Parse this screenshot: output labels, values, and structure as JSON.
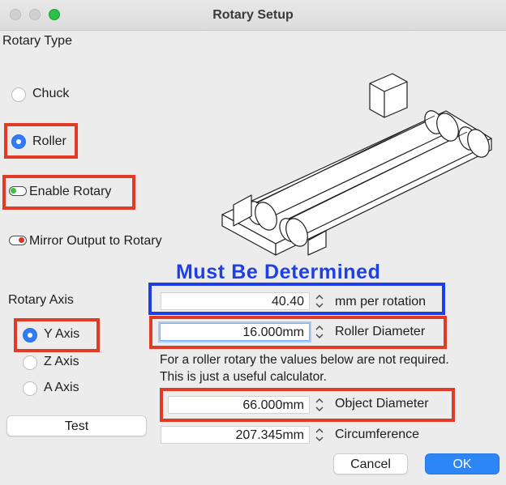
{
  "window": {
    "title": "Rotary Setup"
  },
  "rotary_type": {
    "heading": "Rotary Type",
    "options": [
      {
        "label": "Chuck",
        "selected": false
      },
      {
        "label": "Roller",
        "selected": true
      }
    ]
  },
  "toggles": {
    "enable_rotary": {
      "label": "Enable Rotary",
      "on": true,
      "color": "#39c23c"
    },
    "mirror_output": {
      "label": "Mirror Output to Rotary",
      "on": false,
      "color": "#d9342b"
    }
  },
  "rotary_axis": {
    "heading": "Rotary Axis",
    "options": [
      {
        "label": "Y Axis",
        "selected": true
      },
      {
        "label": "Z Axis",
        "selected": false
      },
      {
        "label": "A Axis",
        "selected": false
      }
    ]
  },
  "annotation": {
    "headline": "Must Be Determined"
  },
  "fields": {
    "mm_per_rotation": {
      "value": "40.40",
      "label": "mm per rotation"
    },
    "roller_diameter": {
      "value": "16.000mm",
      "label": "Roller Diameter"
    },
    "object_diameter": {
      "value": "66.000mm",
      "label": "Object Diameter"
    },
    "circumference": {
      "value": "207.345mm",
      "label": "Circumference"
    }
  },
  "note": {
    "line1": "For a roller rotary the values below are not required.",
    "line2": "This is just a useful calculator."
  },
  "buttons": {
    "test": "Test",
    "cancel": "Cancel",
    "ok": "OK"
  },
  "colors": {
    "highlight_red": "#e03b27",
    "highlight_blue": "#1d3fe6",
    "accent": "#2e86f6"
  }
}
